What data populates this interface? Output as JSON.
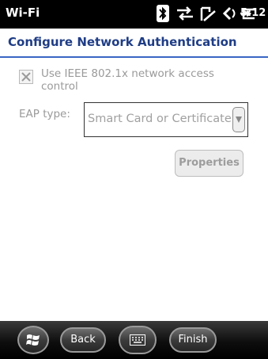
{
  "status_bar": {
    "title": "Wi-Fi",
    "time": "5:12",
    "icons": [
      "bluetooth-icon",
      "data-sync-icon",
      "signal-icon",
      "volume-icon",
      "battery-icon"
    ]
  },
  "page": {
    "title": "Configure Network Authentication"
  },
  "form": {
    "checkbox_label": "Use IEEE 802.1x network access control",
    "checkbox_checked": true,
    "eap_label": "EAP type:",
    "eap_value": "Smart Card or Certificate",
    "properties_label": "Properties"
  },
  "taskbar": {
    "back_label": "Back",
    "finish_label": "Finish"
  },
  "colors": {
    "title_text": "#1f3d86",
    "title_rule": "#3a66c4",
    "disabled_text": "#9a9a9a"
  }
}
